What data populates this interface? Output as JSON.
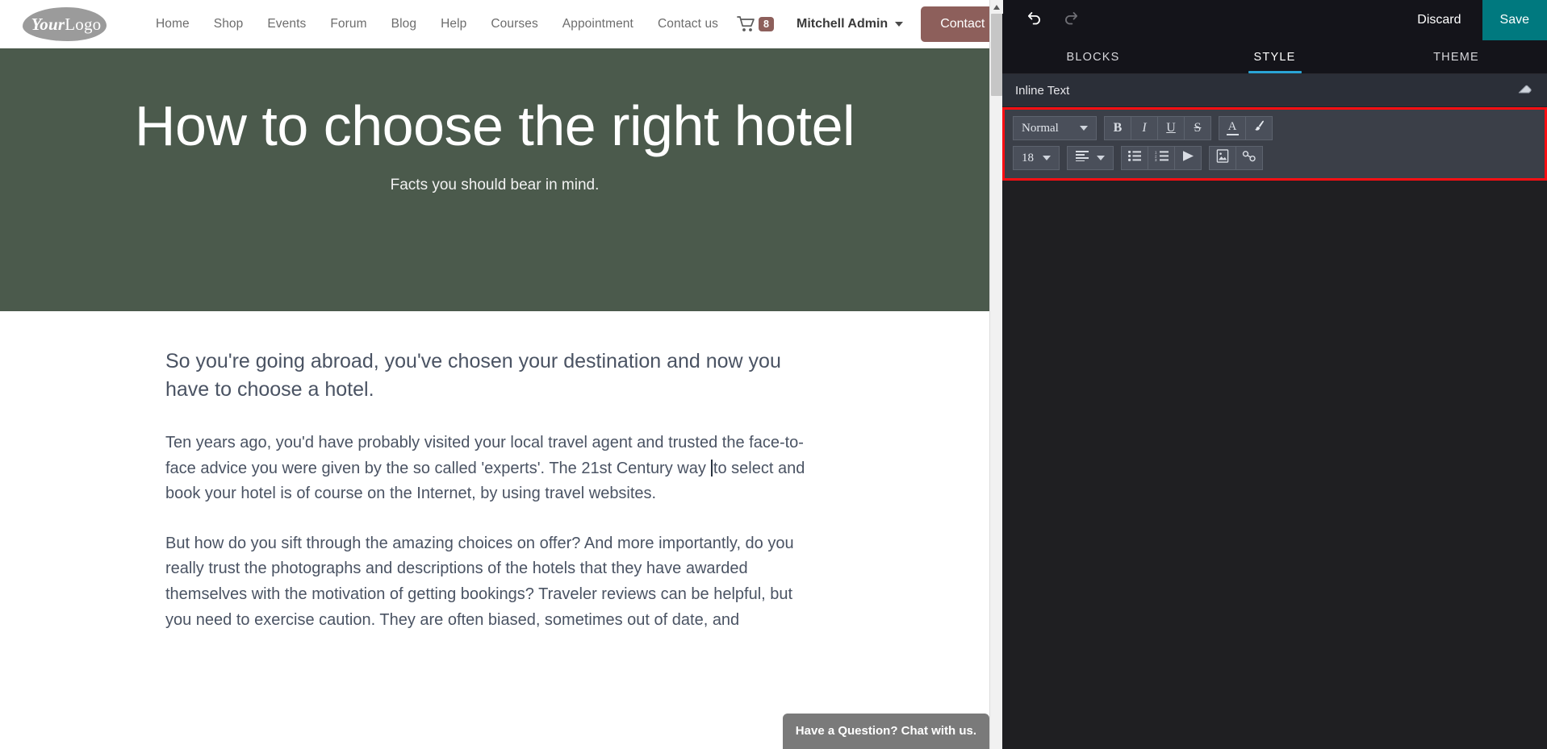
{
  "website": {
    "logo": {
      "bold_part": "Your",
      "light_part": "Logo",
      "icon": "logo-blob-icon"
    },
    "nav_links": [
      {
        "label": "Home"
      },
      {
        "label": "Shop"
      },
      {
        "label": "Events"
      },
      {
        "label": "Forum"
      },
      {
        "label": "Blog"
      },
      {
        "label": "Help"
      },
      {
        "label": "Courses"
      },
      {
        "label": "Appointment"
      },
      {
        "label": "Contact us"
      }
    ],
    "cart": {
      "icon": "shopping-cart-icon",
      "count": "8"
    },
    "user": {
      "name": "Mitchell Admin",
      "icon": "chevron-down-icon"
    },
    "cta_button": {
      "label": "Contact Us",
      "color": "#8d5f5b"
    },
    "hero": {
      "title": "How to choose the right hotel",
      "subtitle": "Facts you should bear in mind.",
      "background_color": "#4b5a4c"
    },
    "article": {
      "lead": "So you're going abroad, you've chosen your destination and now you have to choose a hotel.",
      "paragraph_2_before_cursor": "Ten years ago, you'd have probably visited your local travel agent and trusted the face-to-face advice you were given by the so called 'experts'. The 21st Century way ",
      "paragraph_2_after_cursor": "to select and book your hotel is of course on the Internet, by using travel websites.",
      "paragraph_3": "But how do you sift through the amazing choices on offer? And more importantly, do you really trust the photographs and descriptions of the hotels that they have awarded themselves with the motivation of getting bookings? Traveler reviews can be helpful, but you need to exercise caution. They are often biased, sometimes out of date, and"
    },
    "chat_widget": {
      "label": "Have a Question? Chat with us."
    },
    "scrollbar": {
      "up_arrow_icon": "scroll-up-arrow-icon"
    }
  },
  "editor": {
    "topbar": {
      "undo": {
        "icon": "undo-icon",
        "label": ""
      },
      "redo": {
        "icon": "redo-icon",
        "label": ""
      },
      "discard_label": "Discard",
      "save_label": "Save",
      "save_color": "#00797f"
    },
    "tabs": [
      {
        "label": "BLOCKS",
        "active": false
      },
      {
        "label": "STYLE",
        "active": true
      },
      {
        "label": "THEME",
        "active": false
      }
    ],
    "active_tab_indicator_color": "#2aa5d6",
    "panel": {
      "section_title": "Inline Text",
      "eraser_icon": "eraser-icon",
      "highlight_border_color": "#fb0f13"
    },
    "toolbar": {
      "row1": {
        "style_select": {
          "value": "Normal",
          "icon": "chevron-down-icon"
        },
        "bold": {
          "label": "B",
          "icon": "bold-icon"
        },
        "italic": {
          "label": "I",
          "icon": "italic-icon"
        },
        "underline": {
          "label": "U",
          "icon": "underline-icon"
        },
        "strikethrough": {
          "label": "S",
          "icon": "strikethrough-icon"
        },
        "font_color": {
          "label": "A",
          "icon": "font-color-icon"
        },
        "background_color": {
          "icon": "paint-brush-icon"
        }
      },
      "row2": {
        "font_size": {
          "value": "18",
          "icon": "chevron-down-icon"
        },
        "align": {
          "icon": "align-left-icon"
        },
        "unordered_list": {
          "icon": "bulleted-list-icon"
        },
        "ordered_list": {
          "icon": "numbered-list-icon"
        },
        "media": {
          "icon": "play-triangle-icon"
        },
        "image": {
          "icon": "insert-image-icon"
        },
        "link": {
          "icon": "link-icon"
        }
      }
    }
  }
}
